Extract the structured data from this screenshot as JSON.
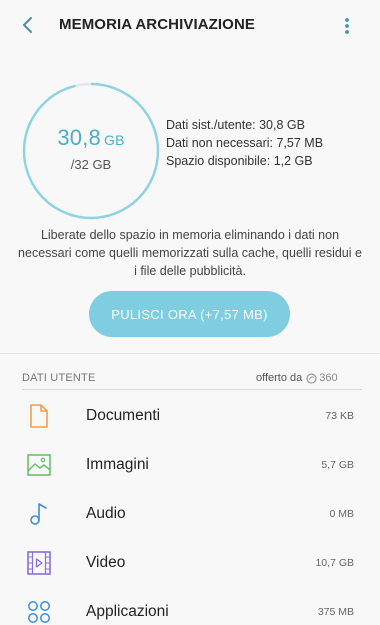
{
  "header": {
    "title": "MEMORIA ARCHIVIAZIONE",
    "back_icon": "chevron-left-icon",
    "more_icon": "more-vertical-icon"
  },
  "storage": {
    "used_value": "30,8",
    "used_unit": "GB",
    "total": "/32 GB",
    "used_fraction": 0.9625,
    "ring_color": "#8ed3e4",
    "track_color": "#e6e6e6"
  },
  "stats": {
    "system_user": "Dati sist./utente: 30,8 GB",
    "unnecessary": "Dati non necessari: 7,57 MB",
    "available": "Spazio disponibile: 1,2 GB"
  },
  "description": "Liberate dello spazio in memoria eliminando i dati non necessari come quelli memorizzati sulla cache, quelli residui e i file delle pubblicità.",
  "clean_button": "PULISCI ORA (+7,57 MB)",
  "section": {
    "title": "DATI UTENTE",
    "sponsor_label": "offerto da",
    "sponsor_brand": "360"
  },
  "items": [
    {
      "name": "Documenti",
      "size": "73 KB",
      "icon": "document-icon",
      "color": "#f0a04b"
    },
    {
      "name": "Immagini",
      "size": "5,7 GB",
      "icon": "image-icon",
      "color": "#6cc06a"
    },
    {
      "name": "Audio",
      "size": "0 MB",
      "icon": "music-note-icon",
      "color": "#3a8fd8"
    },
    {
      "name": "Video",
      "size": "10,7 GB",
      "icon": "video-icon",
      "color": "#8a6fd6"
    },
    {
      "name": "Applicazioni",
      "size": "375 MB",
      "icon": "apps-icon",
      "color": "#3a8fd8"
    }
  ]
}
